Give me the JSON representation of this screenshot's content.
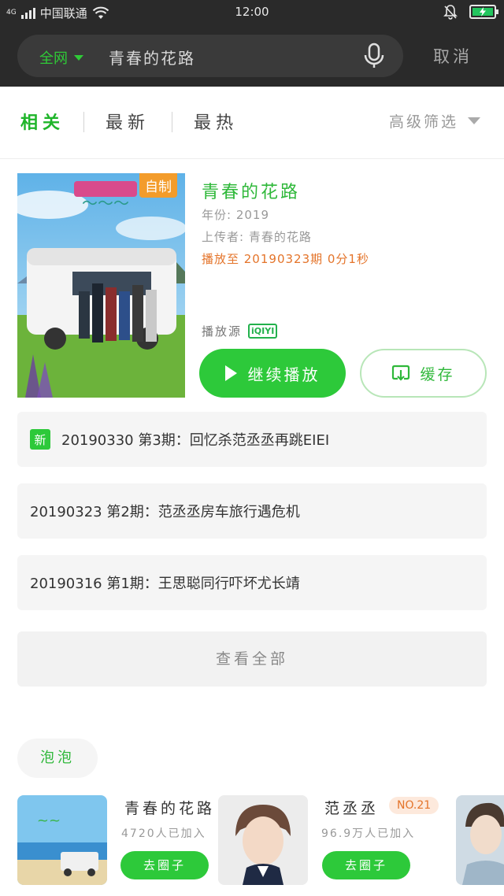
{
  "status_bar": {
    "network": "4G",
    "carrier": "中国联通",
    "time": "12:00"
  },
  "search": {
    "scope": "全网",
    "query": "青春的花路",
    "cancel": "取消"
  },
  "tabs": [
    {
      "label": "相关",
      "active": true
    },
    {
      "label": "最新",
      "active": false
    },
    {
      "label": "最热",
      "active": false
    }
  ],
  "filter_label": "高级筛选",
  "show": {
    "poster_badge": "自制",
    "title": "青春的花路",
    "year": "年份: 2019",
    "uploader": "上传者: 青春的花路",
    "progress": "播放至 20190323期 0分1秒",
    "source_label": "播放源",
    "source_logo": "iQIYI",
    "play_label": "继续播放",
    "cache_label": "缓存"
  },
  "episodes": [
    {
      "new": true,
      "new_label": "新",
      "title": "20190330 第3期：回忆杀范丞丞再跳EIEI"
    },
    {
      "new": false,
      "title": "20190323 第2期：范丞丞房车旅行遇危机"
    },
    {
      "new": false,
      "title": "20190316 第1期：王思聪同行吓坏尤长靖"
    }
  ],
  "view_all": "查看全部",
  "bubble": {
    "section_label": "泡泡",
    "circles": [
      {
        "name": "青春的花路",
        "count": "4720人已加入",
        "button": "去圈子"
      },
      {
        "name": "范丞丞",
        "count": "96.9万人已加入",
        "button": "去圈子",
        "rank": "NO.21"
      }
    ]
  },
  "colors": {
    "accent_green": "#2dc93a",
    "progress_orange": "#e4742a",
    "header_dark": "#2a2a2a"
  }
}
